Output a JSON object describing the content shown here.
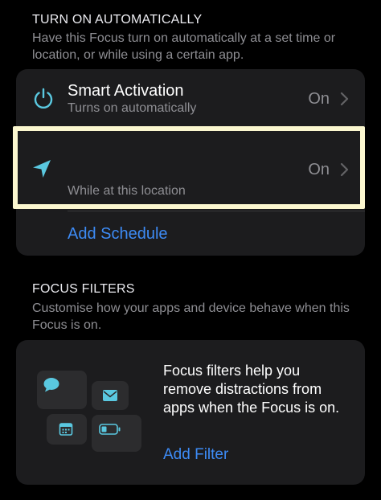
{
  "turn_on": {
    "header": "TURN ON AUTOMATICALLY",
    "description": "Have this Focus turn on automatically at a set time or location, or while using a certain app."
  },
  "smart_activation": {
    "title": "Smart Activation",
    "subtitle": "Turns on automatically",
    "value": "On",
    "icon": "power-icon"
  },
  "location_row": {
    "subtitle": "While at this location",
    "value": "On",
    "icon": "location-arrow-icon"
  },
  "add_schedule": "Add Schedule",
  "focus_filters": {
    "header": "FOCUS FILTERS",
    "description": "Customise how your apps and device behave when this Focus is on.",
    "card_text": "Focus filters help you remove distractions from apps when the Focus is on.",
    "add_filter": "Add Filter"
  },
  "colors": {
    "accent": "#3d8bf5",
    "icon_teal": "#5ac8e0",
    "highlight": "#fbf7cf"
  }
}
